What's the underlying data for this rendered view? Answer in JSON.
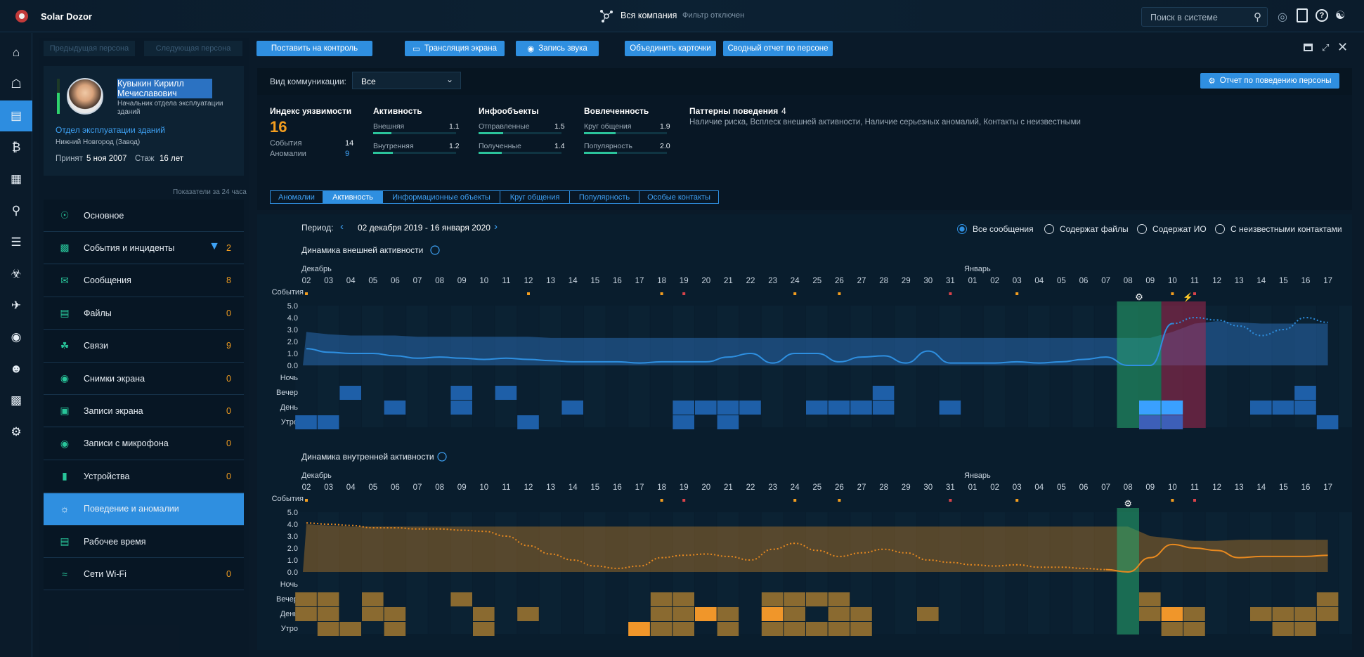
{
  "app": {
    "title": "Solar Dozor"
  },
  "header": {
    "company": "Вся компания",
    "filter": "Фильтр отключен",
    "search_placeholder": "Поиск в системе"
  },
  "left_nav": [
    "home-icon",
    "dashboard-icon",
    "persons-icon",
    "bitcoin-icon",
    "calendar-icon",
    "search-icon",
    "list-icon",
    "spy-icon",
    "plane-icon",
    "binoculars-icon",
    "users-icon",
    "book-icon",
    "settings-icon"
  ],
  "person_nav": {
    "prev": "Предыдущая персона",
    "next": "Следующая персона"
  },
  "toolbar": {
    "control": "Поставить на контроль",
    "stream": "Трансляция экрана",
    "record": "Запись звука",
    "merge": "Объединить карточки",
    "report": "Сводный отчет по персоне"
  },
  "person": {
    "name": "Кувыкин Кирилл Мечиславович",
    "position": "Начальник отдела эксплуатации зданий",
    "department": "Отдел эксплуатации зданий",
    "location": "Нижний Новгород (Завод)",
    "hired_label": "Принят",
    "hired": "5 ноя 2007",
    "tenure_label": "Стаж",
    "tenure": "16 лет"
  },
  "indicators_note": "Показатели за 24 часа",
  "menu": [
    {
      "label": "Основное",
      "count": ""
    },
    {
      "label": "События и инциденты",
      "count": "2"
    },
    {
      "label": "Сообщения",
      "count": "8"
    },
    {
      "label": "Файлы",
      "count": "0"
    },
    {
      "label": "Связи",
      "count": "9"
    },
    {
      "label": "Снимки экрана",
      "count": "0"
    },
    {
      "label": "Записи экрана",
      "count": "0"
    },
    {
      "label": "Записи с микрофона",
      "count": "0"
    },
    {
      "label": "Устройства",
      "count": "0"
    },
    {
      "label": "Поведение и аномалии",
      "count": ""
    },
    {
      "label": "Рабочее время",
      "count": ""
    },
    {
      "label": "Сети Wi-Fi",
      "count": "0"
    }
  ],
  "comm": {
    "label": "Вид коммуникации:",
    "value": "Все",
    "report_button": "Отчет по поведению персоны"
  },
  "metrics": {
    "vuln_title": "Индекс уязвимости",
    "vuln_value": "16",
    "events_label": "События",
    "events_value": "14",
    "anomalies_label": "Аномалии",
    "anomalies_value": "9",
    "activity_title": "Активность",
    "activity": [
      {
        "label": "Внешняя",
        "value": "1.1",
        "level": 0.22
      },
      {
        "label": "Внутренняя",
        "value": "1.2",
        "level": 0.24
      }
    ],
    "info_title": "Инфообъекты",
    "info": [
      {
        "label": "Отправленные",
        "value": "1.5",
        "level": 0.3
      },
      {
        "label": "Полученные",
        "value": "1.4",
        "level": 0.28
      }
    ],
    "involve_title": "Вовлеченность",
    "involve": [
      {
        "label": "Круг общения",
        "value": "1.9",
        "level": 0.38
      },
      {
        "label": "Популярность",
        "value": "2.0",
        "level": 0.4
      }
    ],
    "patterns_title": "Паттерны поведения",
    "patterns_count": "4",
    "patterns_text": "Наличие риска, Всплеск внешней активности, Наличие серьезных аномалий, Контакты с неизвестными"
  },
  "tabs": [
    "Аномалии",
    "Активность",
    "Информационные объекты",
    "Круг общения",
    "Популярность",
    "Особые контакты"
  ],
  "period": {
    "label": "Период:",
    "value": "02 декабря 2019 - 16 января 2020"
  },
  "filters": [
    "Все сообщения",
    "Содержат файлы",
    "Содержат ИО",
    "С неизвестными контактами"
  ],
  "chart_data": [
    {
      "type": "area",
      "title": "Динамика внешней активности",
      "month_labels": [
        "Декабрь",
        "Январь"
      ],
      "x": [
        "02",
        "03",
        "04",
        "05",
        "06",
        "07",
        "08",
        "09",
        "10",
        "11",
        "12",
        "13",
        "14",
        "15",
        "16",
        "17",
        "18",
        "19",
        "20",
        "21",
        "22",
        "23",
        "24",
        "25",
        "26",
        "27",
        "28",
        "29",
        "30",
        "31",
        "01",
        "02",
        "03",
        "04",
        "05",
        "06",
        "07",
        "08",
        "09",
        "10",
        "11",
        "12",
        "13",
        "14",
        "15",
        "16",
        "17"
      ],
      "events_label": "События",
      "yticks": [
        "5.0",
        "4.0",
        "3.0",
        "2.0",
        "1.0",
        "0.0"
      ],
      "ylim": [
        0,
        5
      ],
      "color": "#2e8fe0",
      "series": [
        {
          "values": [
            1.4,
            1.1,
            1.0,
            1.0,
            0.8,
            0.6,
            0.7,
            0.6,
            0.5,
            0.6,
            0.5,
            0.4,
            0.3,
            0.3,
            0.3,
            0.2,
            0.3,
            0.3,
            0.3,
            0.7,
            1.0,
            0.2,
            1.0,
            1.0,
            0.3,
            0.7,
            0.8,
            0.2,
            1.2,
            0.2,
            0.2,
            0.2,
            0.3,
            0.2,
            0.3,
            0.5,
            0.7,
            0.0,
            0.0,
            3.5,
            4.0,
            3.8,
            3.3,
            2.5,
            3.0,
            4.0,
            3.6,
            3.2
          ]
        }
      ],
      "band_upper": [
        2.8,
        2.6,
        2.5,
        2.5,
        2.5,
        2.4,
        2.4,
        2.4,
        2.4,
        2.4,
        2.4,
        2.3,
        2.3,
        2.3,
        2.3,
        2.3,
        2.3,
        2.3,
        2.3,
        2.3,
        2.3,
        2.3,
        2.3,
        2.3,
        2.3,
        2.3,
        2.3,
        2.3,
        2.3,
        2.3,
        2.3,
        2.3,
        2.3,
        2.3,
        2.3,
        2.3,
        2.3,
        2.3,
        2.3,
        2.8,
        3.5,
        3.7,
        3.6,
        3.5,
        3.5,
        3.5,
        3.5
      ],
      "forecast_from": "10",
      "heatmap_rows": [
        "Ночь",
        "Вечер",
        "День",
        "Утро"
      ]
    },
    {
      "type": "area",
      "title": "Динамика внутренней активности",
      "month_labels": [
        "Декабрь",
        "Январь"
      ],
      "x": [
        "02",
        "03",
        "04",
        "05",
        "06",
        "07",
        "08",
        "09",
        "10",
        "11",
        "12",
        "13",
        "14",
        "15",
        "16",
        "17",
        "18",
        "19",
        "20",
        "21",
        "22",
        "23",
        "24",
        "25",
        "26",
        "27",
        "28",
        "29",
        "30",
        "31",
        "01",
        "02",
        "03",
        "04",
        "05",
        "06",
        "07",
        "08",
        "09",
        "10",
        "11",
        "12",
        "13",
        "14",
        "15",
        "16",
        "17"
      ],
      "events_label": "События",
      "yticks": [
        "5.0",
        "4.0",
        "3.0",
        "2.0",
        "1.0",
        "0.0"
      ],
      "ylim": [
        0,
        5
      ],
      "color": "#e8891f",
      "series": [
        {
          "values": [
            4.1,
            4.0,
            3.9,
            3.7,
            3.7,
            3.6,
            3.6,
            3.5,
            3.4,
            3.0,
            2.2,
            1.5,
            1.0,
            0.5,
            0.3,
            0.5,
            1.2,
            1.4,
            1.5,
            1.3,
            1.0,
            1.9,
            2.4,
            1.8,
            1.3,
            1.6,
            1.9,
            1.6,
            1.0,
            0.8,
            0.6,
            0.5,
            0.6,
            0.4,
            0.4,
            0.3,
            0.2,
            0.0,
            1.2,
            2.3,
            2.0,
            1.8,
            1.2,
            1.3,
            1.3,
            1.3,
            1.4
          ]
        }
      ],
      "band_upper": [
        4.0,
        3.9,
        3.8,
        3.8,
        3.8,
        3.8,
        3.8,
        3.8,
        3.8,
        3.8,
        3.8,
        3.8,
        3.8,
        3.8,
        3.8,
        3.8,
        3.8,
        3.8,
        3.8,
        3.8,
        3.8,
        3.8,
        3.8,
        3.8,
        3.8,
        3.8,
        3.8,
        3.8,
        3.8,
        3.8,
        3.8,
        3.8,
        3.8,
        3.8,
        3.8,
        3.8,
        3.8,
        3.8,
        3.0,
        2.8,
        2.6,
        2.6,
        2.7,
        2.7,
        2.7,
        2.7,
        2.7
      ],
      "forecast_until": "07",
      "heatmap_rows": [
        "Ночь",
        "Вечер",
        "День",
        "Утро"
      ]
    }
  ]
}
